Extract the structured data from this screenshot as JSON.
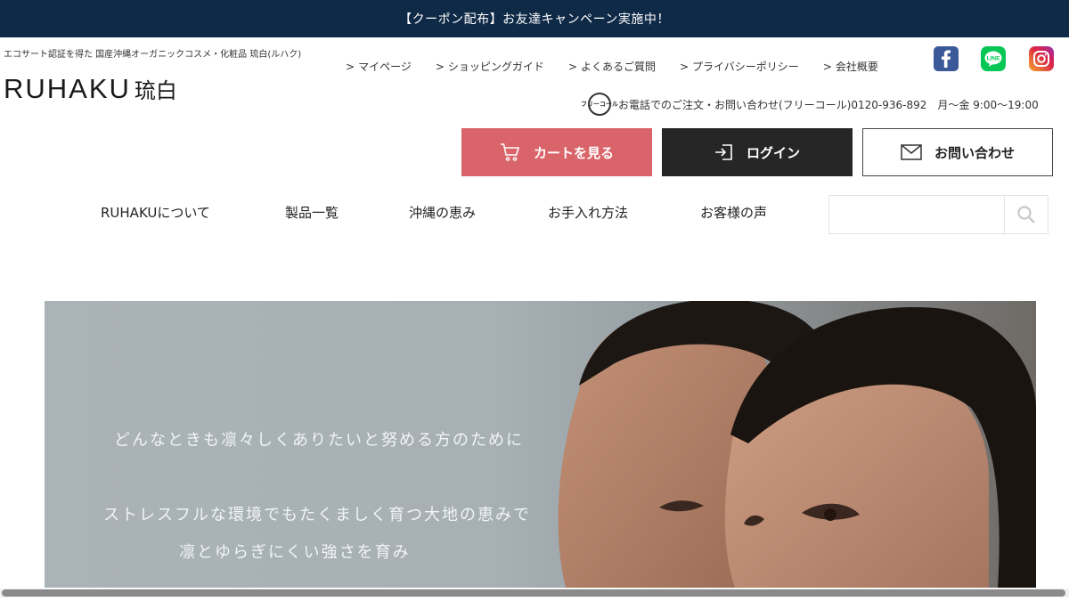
{
  "top_banner": {
    "text": "【クーポン配布】お友達キャンペーン実施中！"
  },
  "header": {
    "tagline": "エコサート認証を得た 国産沖縄オーガニックコスメ・化粧品 琉白(ルハク)",
    "logo_en": "RUHAKU",
    "logo_ja": "琉白",
    "util_nav": [
      {
        "label": "マイページ"
      },
      {
        "label": "ショッピングガイド"
      },
      {
        "label": "よくあるご質問"
      },
      {
        "label": "プライバシーポリシー"
      },
      {
        "label": "会社概要"
      }
    ],
    "util_chevron": ">",
    "sns": [
      {
        "name": "facebook-icon",
        "color": "#3b5998"
      },
      {
        "name": "line-icon",
        "color": "#06c755"
      },
      {
        "name": "instagram-icon",
        "color": "#dc2743"
      }
    ],
    "phone_badge": "フリーコール",
    "phone_text": "お電話でのご注文・お問い合わせ(フリーコール)0120-936-892　月〜金 9:00〜19:00"
  },
  "buttons": {
    "cart": "カートを見る",
    "login": "ログイン",
    "contact": "お問い合わせ"
  },
  "main_nav": [
    {
      "label": "RUHAKUについて"
    },
    {
      "label": "製品一覧"
    },
    {
      "label": "沖縄の恵み"
    },
    {
      "label": "お手入れ方法"
    },
    {
      "label": "お客様の声"
    }
  ],
  "search": {
    "placeholder": ""
  },
  "hero": {
    "line1": "どんなときも凛々しくありたいと努める方のために",
    "line2": "ストレスフルな環境でもたくましく育つ大地の恵みで",
    "line3": "凛とゆらぎにくい強さを育み"
  },
  "colors": {
    "banner_bg": "#0f2a47",
    "cart_bg": "#d9656b",
    "login_bg": "#262626"
  }
}
